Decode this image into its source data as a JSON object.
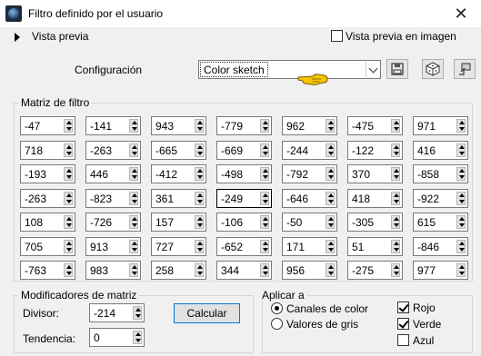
{
  "window": {
    "title": "Filtro definido por el usuario"
  },
  "preview": {
    "label": "Vista previa",
    "image_preview_label": "Vista previa en imagen",
    "image_preview_checked": false
  },
  "config": {
    "label": "Configuración",
    "selected": "Color sketch",
    "icons": [
      "save-icon",
      "randomize-icon",
      "reset-icon"
    ]
  },
  "matrix": {
    "title": "Matriz de filtro",
    "rows": [
      [
        "-47",
        "-141",
        "943",
        "-779",
        "962",
        "-475",
        "971"
      ],
      [
        "718",
        "-263",
        "-665",
        "-669",
        "-244",
        "-122",
        "416"
      ],
      [
        "-193",
        "446",
        "-412",
        "-498",
        "-792",
        "370",
        "-858"
      ],
      [
        "-263",
        "-823",
        "361",
        "-249",
        "-646",
        "418",
        "-922"
      ],
      [
        "108",
        "-726",
        "157",
        "-106",
        "-50",
        "-305",
        "615"
      ],
      [
        "705",
        "913",
        "727",
        "-652",
        "171",
        "51",
        "-846"
      ],
      [
        "-763",
        "983",
        "258",
        "344",
        "956",
        "-275",
        "977"
      ]
    ]
  },
  "modifiers": {
    "title": "Modificadores de matriz",
    "divisor_label": "Divisor:",
    "divisor": "-214",
    "bias_label": "Tendencia:",
    "bias": "0",
    "calc_label": "Calcular"
  },
  "apply": {
    "title": "Aplicar a",
    "options": [
      "Canales de color",
      "Valores de gris"
    ],
    "selected_option": "Canales de color",
    "channels": [
      {
        "label": "Rojo",
        "checked": true
      },
      {
        "label": "Verde",
        "checked": true
      },
      {
        "label": "Azul",
        "checked": false
      }
    ]
  },
  "colors": {
    "dialog_bg": "#f0f0f0",
    "pointer": "#f5c400",
    "focus_blue": "#0078d7"
  }
}
